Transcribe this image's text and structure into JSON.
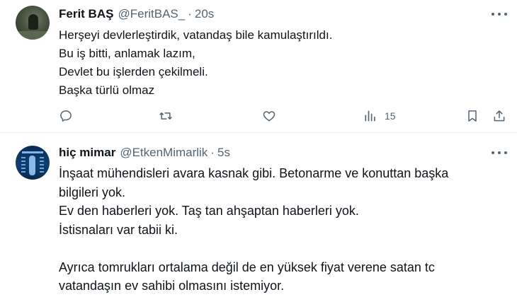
{
  "tweets": [
    {
      "name": "Ferit BAŞ",
      "handle": "@FeritBAS_",
      "separator": "·",
      "time": "20s",
      "text": "Herşeyi devlerleştirdik, vatandaş bile kamulaştırıldı.\nBu iş bitti, anlamak lazım,\nDevlet bu işlerden çekilmeli.\nBaşka türlü olmaz",
      "views_count": "15",
      "icons": [
        "reply-icon",
        "retweet-icon",
        "like-icon",
        "views-icon",
        "bookmark-icon",
        "share-icon",
        "more-icon"
      ]
    },
    {
      "name": "hiç mimar",
      "handle": "@EtkenMimarlik",
      "separator": "·",
      "time": "5s",
      "text": "İnşaat mühendisleri avara kasnak gibi. Betonarme ve konuttan başka\nbilgileri yok.\nEv den haberleri yok. Taş tan ahşaptan haberleri yok.\nİstisnaları var tabii ki.\n\nAyrıca tomrukları ortalama değil de en yüksek fiyat verene satan tc\nvatandaşın ev sahibi olmasını istemiyor.",
      "icons": [
        "more-icon"
      ]
    }
  ],
  "colors": {
    "text_primary": "#0f1419",
    "text_secondary": "#536471",
    "divider": "#eff3f4",
    "background": "#ffffff"
  }
}
